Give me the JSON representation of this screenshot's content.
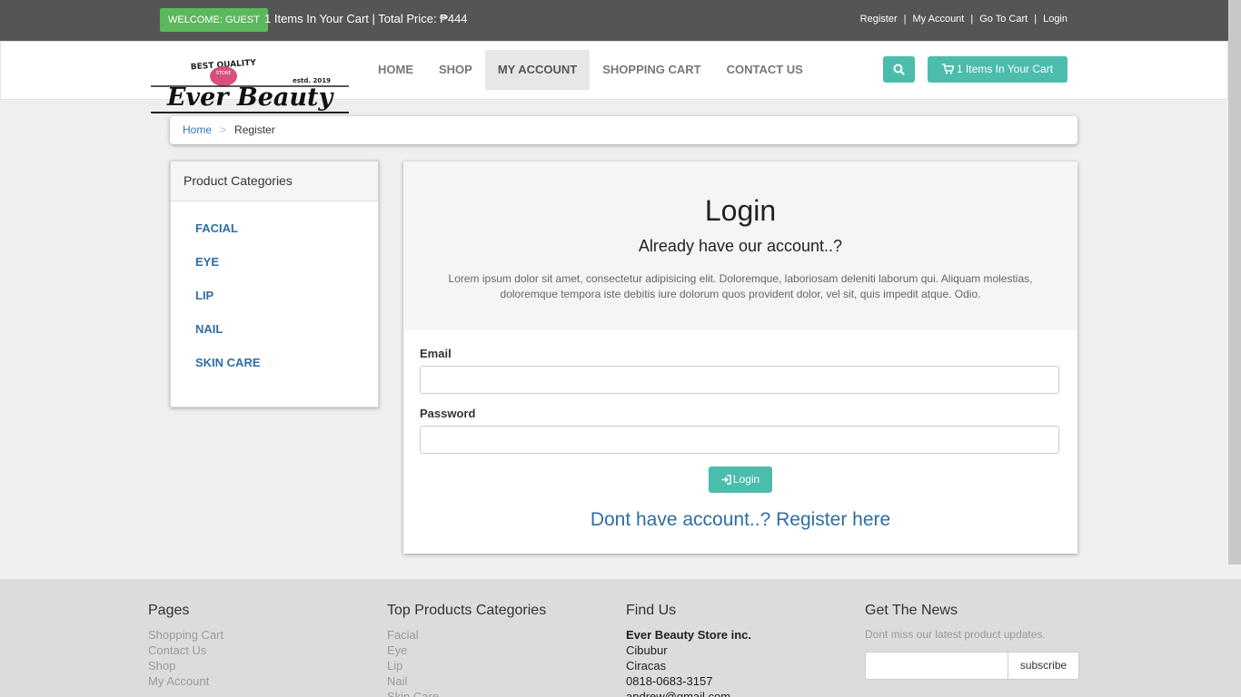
{
  "topbar": {
    "welcome": "WELCOME: GUEST",
    "cart_summary": "1 Items In Your Cart | Total Price: ₱444",
    "links": [
      "Register",
      "My Account",
      "Go To Cart",
      "Login"
    ]
  },
  "brand": {
    "tagline": "BEST QUALITY",
    "store": "STORE",
    "name": "Ever Beauty",
    "established": "estd. 2019"
  },
  "nav": {
    "items": [
      "HOME",
      "SHOP",
      "MY ACCOUNT",
      "SHOPPING CART",
      "CONTACT US"
    ],
    "active": "MY ACCOUNT",
    "search_icon": "search-icon",
    "cart_button": "1 Items In Your Cart"
  },
  "breadcrumb": {
    "home": "Home",
    "separator": ">",
    "current": "Register"
  },
  "sidebar": {
    "title": "Product Categories",
    "categories": [
      "FACIAL",
      "EYE",
      "LIP",
      "NAIL",
      "SKIN CARE"
    ]
  },
  "login": {
    "title": "Login",
    "subtitle": "Already have our account..?",
    "description": "Lorem ipsum dolor sit amet, consectetur adipisicing elit. Doloremque, laboriosam deleniti laborum qui. Aliquam molestias, doloremque tempora iste debitis iure dolorum quos provident dolor, vel sit, quis impedit atque. Odio.",
    "email_label": "Email",
    "email_value": "",
    "password_label": "Password",
    "password_value": "",
    "button": "Login",
    "register_link": "Dont have account..? Register here"
  },
  "footer": {
    "pages": {
      "title": "Pages",
      "links": [
        "Shopping Cart",
        "Contact Us",
        "Shop",
        "My Account"
      ]
    },
    "categories": {
      "title": "Top Products Categories",
      "links": [
        "Facial",
        "Eye",
        "Lip",
        "Nail",
        "Skin Care"
      ]
    },
    "find_us": {
      "title": "Find Us",
      "company": "Ever Beauty Store inc.",
      "lines": [
        "Cibubur",
        "Ciracas",
        "0818-0683-3157",
        "andrew@gmail.com"
      ]
    },
    "news": {
      "title": "Get The News",
      "note": "Dont miss our latest product updates.",
      "input_value": "",
      "button": "subscribe"
    }
  },
  "colors": {
    "topbar": "#555555",
    "accent": "#4cbcac",
    "welcome_badge": "#5cb85c",
    "link": "#337ab7",
    "logo_badge": "#d6517a"
  }
}
